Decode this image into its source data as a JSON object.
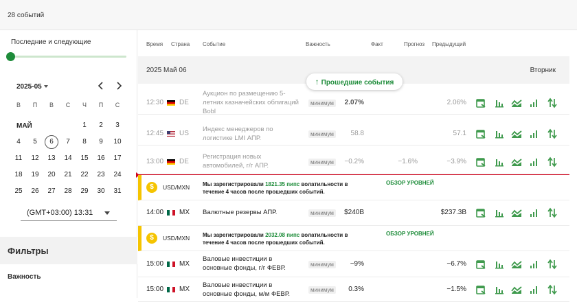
{
  "header": {
    "event_count": "28 событий"
  },
  "sidebar": {
    "range_label": "Последние и следующие",
    "month_select": "2025-05",
    "weekdays": [
      "В",
      "П",
      "В",
      "С",
      "Ч",
      "П",
      "С"
    ],
    "month_name": "МАЙ",
    "days": {
      "d1": "1",
      "d2": "2",
      "d3": "3",
      "d4": "4",
      "d5": "5",
      "d6": "6",
      "d7": "7",
      "d8": "8",
      "d9": "9",
      "d10": "10",
      "d11": "11",
      "d12": "12",
      "d13": "13",
      "d14": "14",
      "d15": "15",
      "d16": "16",
      "d17": "17",
      "d18": "18",
      "d19": "19",
      "d20": "20",
      "d21": "21",
      "d22": "22",
      "d23": "23",
      "d24": "24",
      "d25": "25",
      "d26": "26",
      "d27": "27",
      "d28": "28",
      "d29": "29",
      "d30": "30",
      "d31": "31"
    },
    "timezone": "(GMT+03:00) 13:31",
    "filters_title": "Фильтры",
    "importance_label": "Важность"
  },
  "table": {
    "columns": {
      "time": "Время",
      "country": "Страна",
      "event": "Событие",
      "importance": "Важность",
      "fact": "Факт",
      "forecast": "Прогноз",
      "previous": "Предыдущий"
    },
    "date": "2025 Май 06",
    "weekday": "Вторник",
    "past_button": "Прошедшие события",
    "rows": [
      {
        "time": "12:30",
        "country": "DE",
        "event": "Аукцион по размещению 5-летних казначейских облигаций Bobl",
        "importance": "минимум",
        "fact": "2.07%",
        "forecast": "",
        "previous": "2.06%"
      },
      {
        "time": "12:45",
        "country": "US",
        "event": "Индекс менеджеров по логистике LMI АПР.",
        "importance": "минимум",
        "fact": "58.8",
        "forecast": "",
        "previous": "57.1"
      },
      {
        "time": "13:00",
        "country": "DE",
        "event": "Регистрация новых автомобилей, г/г АПР.",
        "importance": "минимум",
        "fact": "−0.2%",
        "forecast": "−1.6%",
        "previous": "−3.9%"
      },
      {
        "time": "14:00",
        "country": "MX",
        "event": "Валютные резервы АПР.",
        "importance": "минимум",
        "fact": "$240B",
        "forecast": "",
        "previous": "$237.3B"
      },
      {
        "time": "15:00",
        "country": "MX",
        "event": "Валовые инвестиции в основные фонды, г/г ФЕВР.",
        "importance": "минимум",
        "fact": "−9%",
        "forecast": "",
        "previous": "−6.7%"
      },
      {
        "time": "15:00",
        "country": "MX",
        "event": "Валовые инвестиции в основные фонды, м/м ФЕВР.",
        "importance": "минимум",
        "fact": "0.3%",
        "forecast": "",
        "previous": "−1.5%"
      }
    ],
    "alerts": [
      {
        "pair": "USD/MXN",
        "msg_a": "Мы зарегистрировали ",
        "pips": "1821.35 пипс",
        "msg_b": " волатильности в течение 4 часов после прошедших событий.",
        "link": "ОБЗОР УРОВНЕЙ"
      },
      {
        "pair": "USD/MXN",
        "msg_a": "Мы зарегистрировали ",
        "pips": "2032.08 пипс",
        "msg_b": " волатильности в течение 4 часов после прошедших событий.",
        "link": "ОБЗОР УРОВНЕЙ"
      }
    ]
  },
  "colors": {
    "accent": "#1e8c3a",
    "now_line": "#d0021b",
    "alert": "#f5c400"
  }
}
